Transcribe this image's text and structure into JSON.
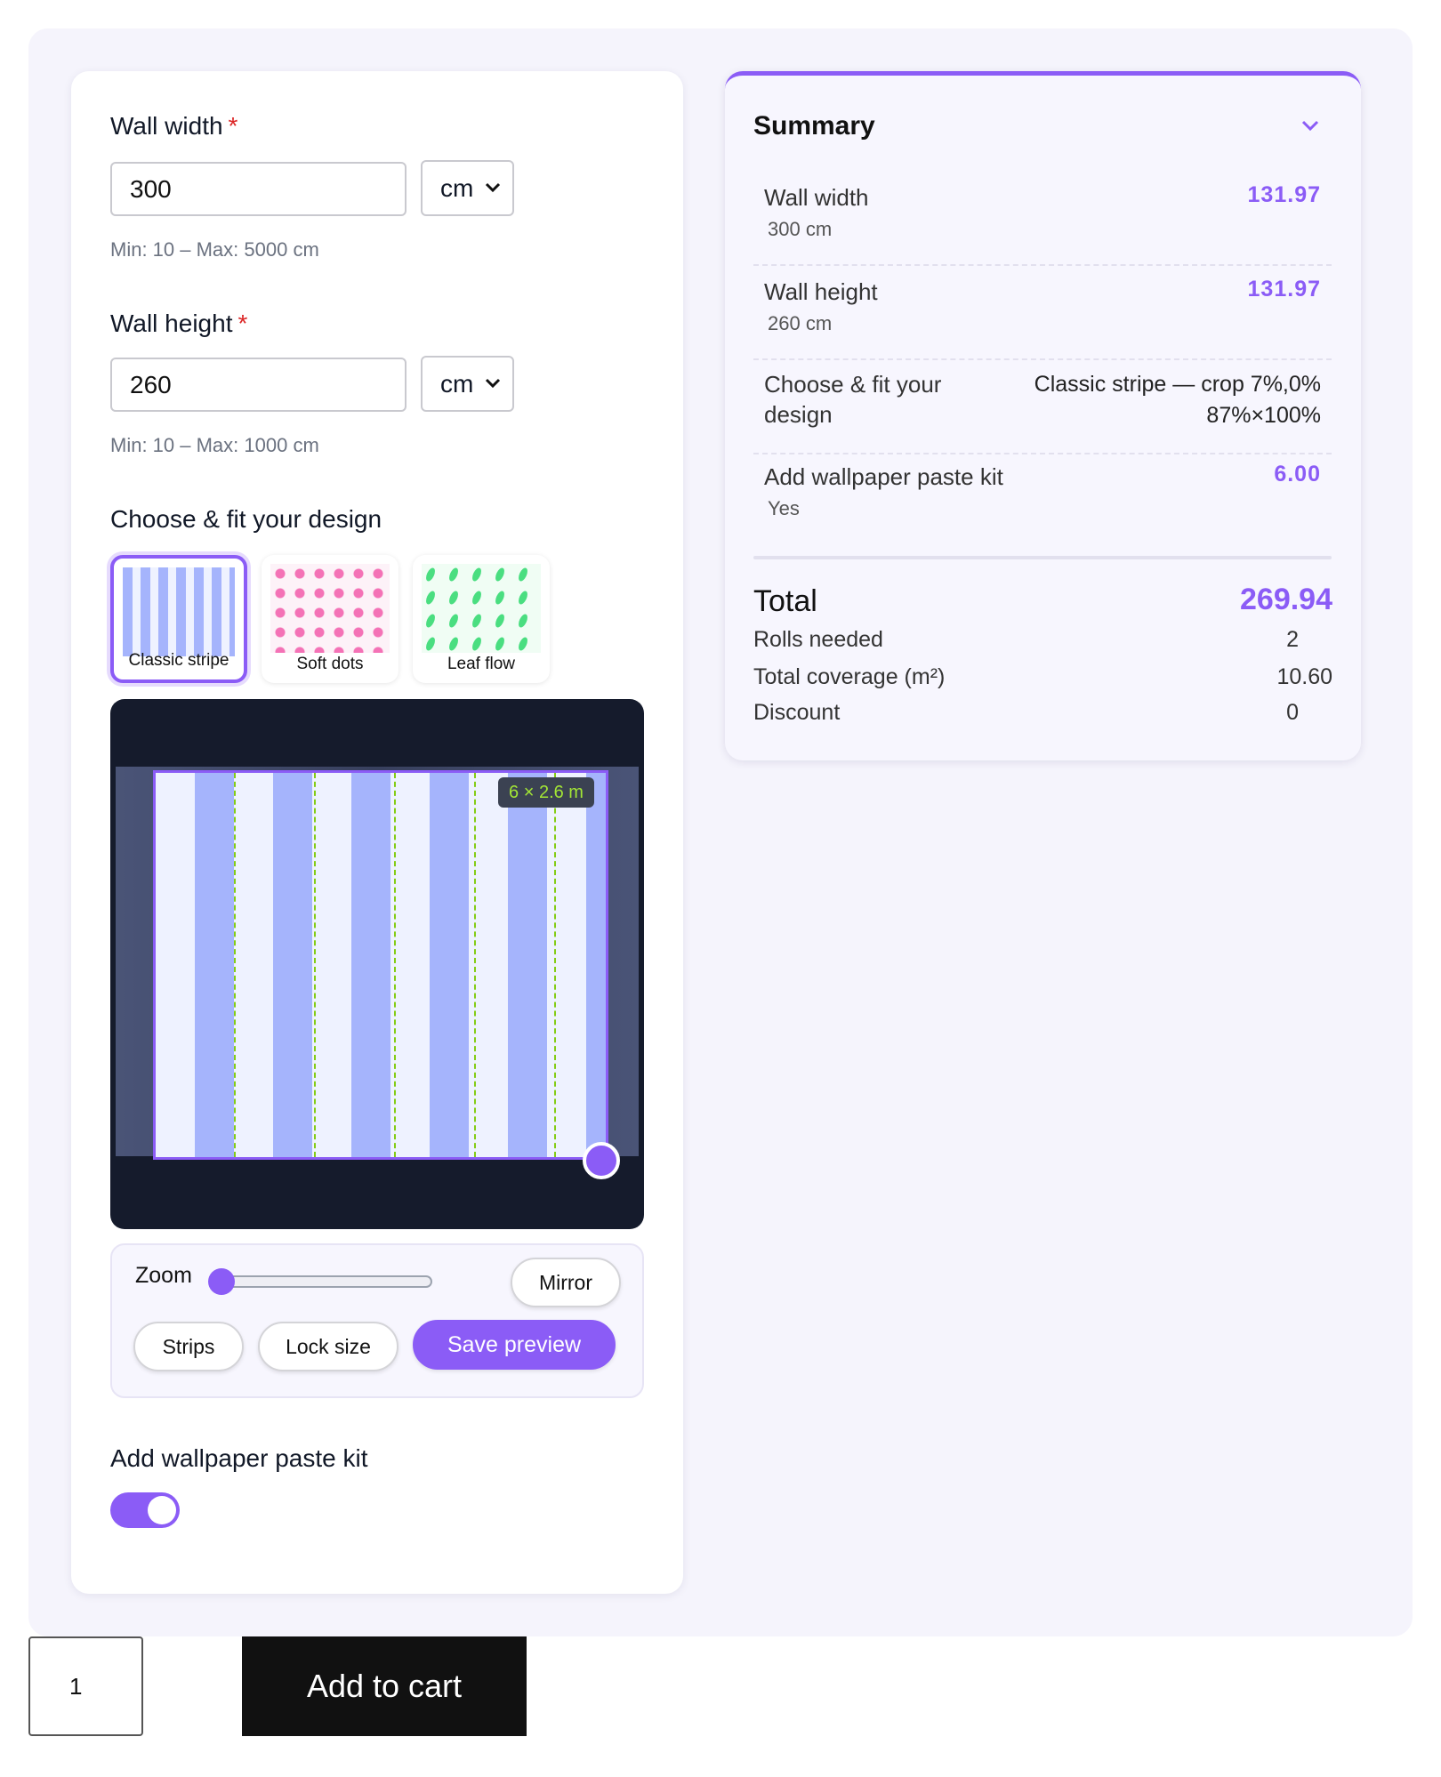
{
  "form": {
    "wall_width": {
      "label": "Wall width",
      "required_mark": "*",
      "value": "300",
      "unit": "cm",
      "hint": "Min: 10 – Max: 5000 cm"
    },
    "wall_height": {
      "label": "Wall height",
      "required_mark": "*",
      "value": "260",
      "unit": "cm",
      "hint": "Min: 10 – Max: 1000 cm"
    },
    "design": {
      "title": "Choose & fit your design",
      "options": [
        {
          "label": "Classic stripe",
          "selected": true
        },
        {
          "label": "Soft dots",
          "selected": false
        },
        {
          "label": "Leaf flow",
          "selected": false
        }
      ],
      "preview_dimension": "6 × 2.6 m"
    },
    "controls": {
      "zoom_label": "Zoom",
      "zoom_value": 0,
      "mirror": "Mirror",
      "strips": "Strips",
      "lock_size": "Lock size",
      "save_preview": "Save preview"
    },
    "paste_kit": {
      "title": "Add wallpaper paste kit",
      "enabled": true
    }
  },
  "summary": {
    "title": "Summary",
    "rows": [
      {
        "name": "Wall width",
        "sub": "300 cm",
        "value": "131.97"
      },
      {
        "name": "Wall height",
        "sub": "260 cm",
        "value": "131.97"
      },
      {
        "name": "Choose & fit your design",
        "value_line1": "Classic stripe — crop 7%,0%",
        "value_line2": "87%×100%"
      },
      {
        "name": "Add wallpaper paste kit",
        "sub": "Yes",
        "value": "6.00"
      }
    ],
    "total_label": "Total",
    "total_value": "269.94",
    "rolls_label": "Rolls needed",
    "rolls_value": "2",
    "coverage_label": "Total coverage (m²)",
    "coverage_value": "10.60",
    "discount_label": "Discount",
    "discount_value": "0"
  },
  "cart": {
    "quantity": "1",
    "button": "Add to cart"
  },
  "colors": {
    "accent": "#8b5cf6",
    "stripe": "#a5b4fc",
    "preview_bg": "#151b2c",
    "seam": "#84cc16"
  }
}
